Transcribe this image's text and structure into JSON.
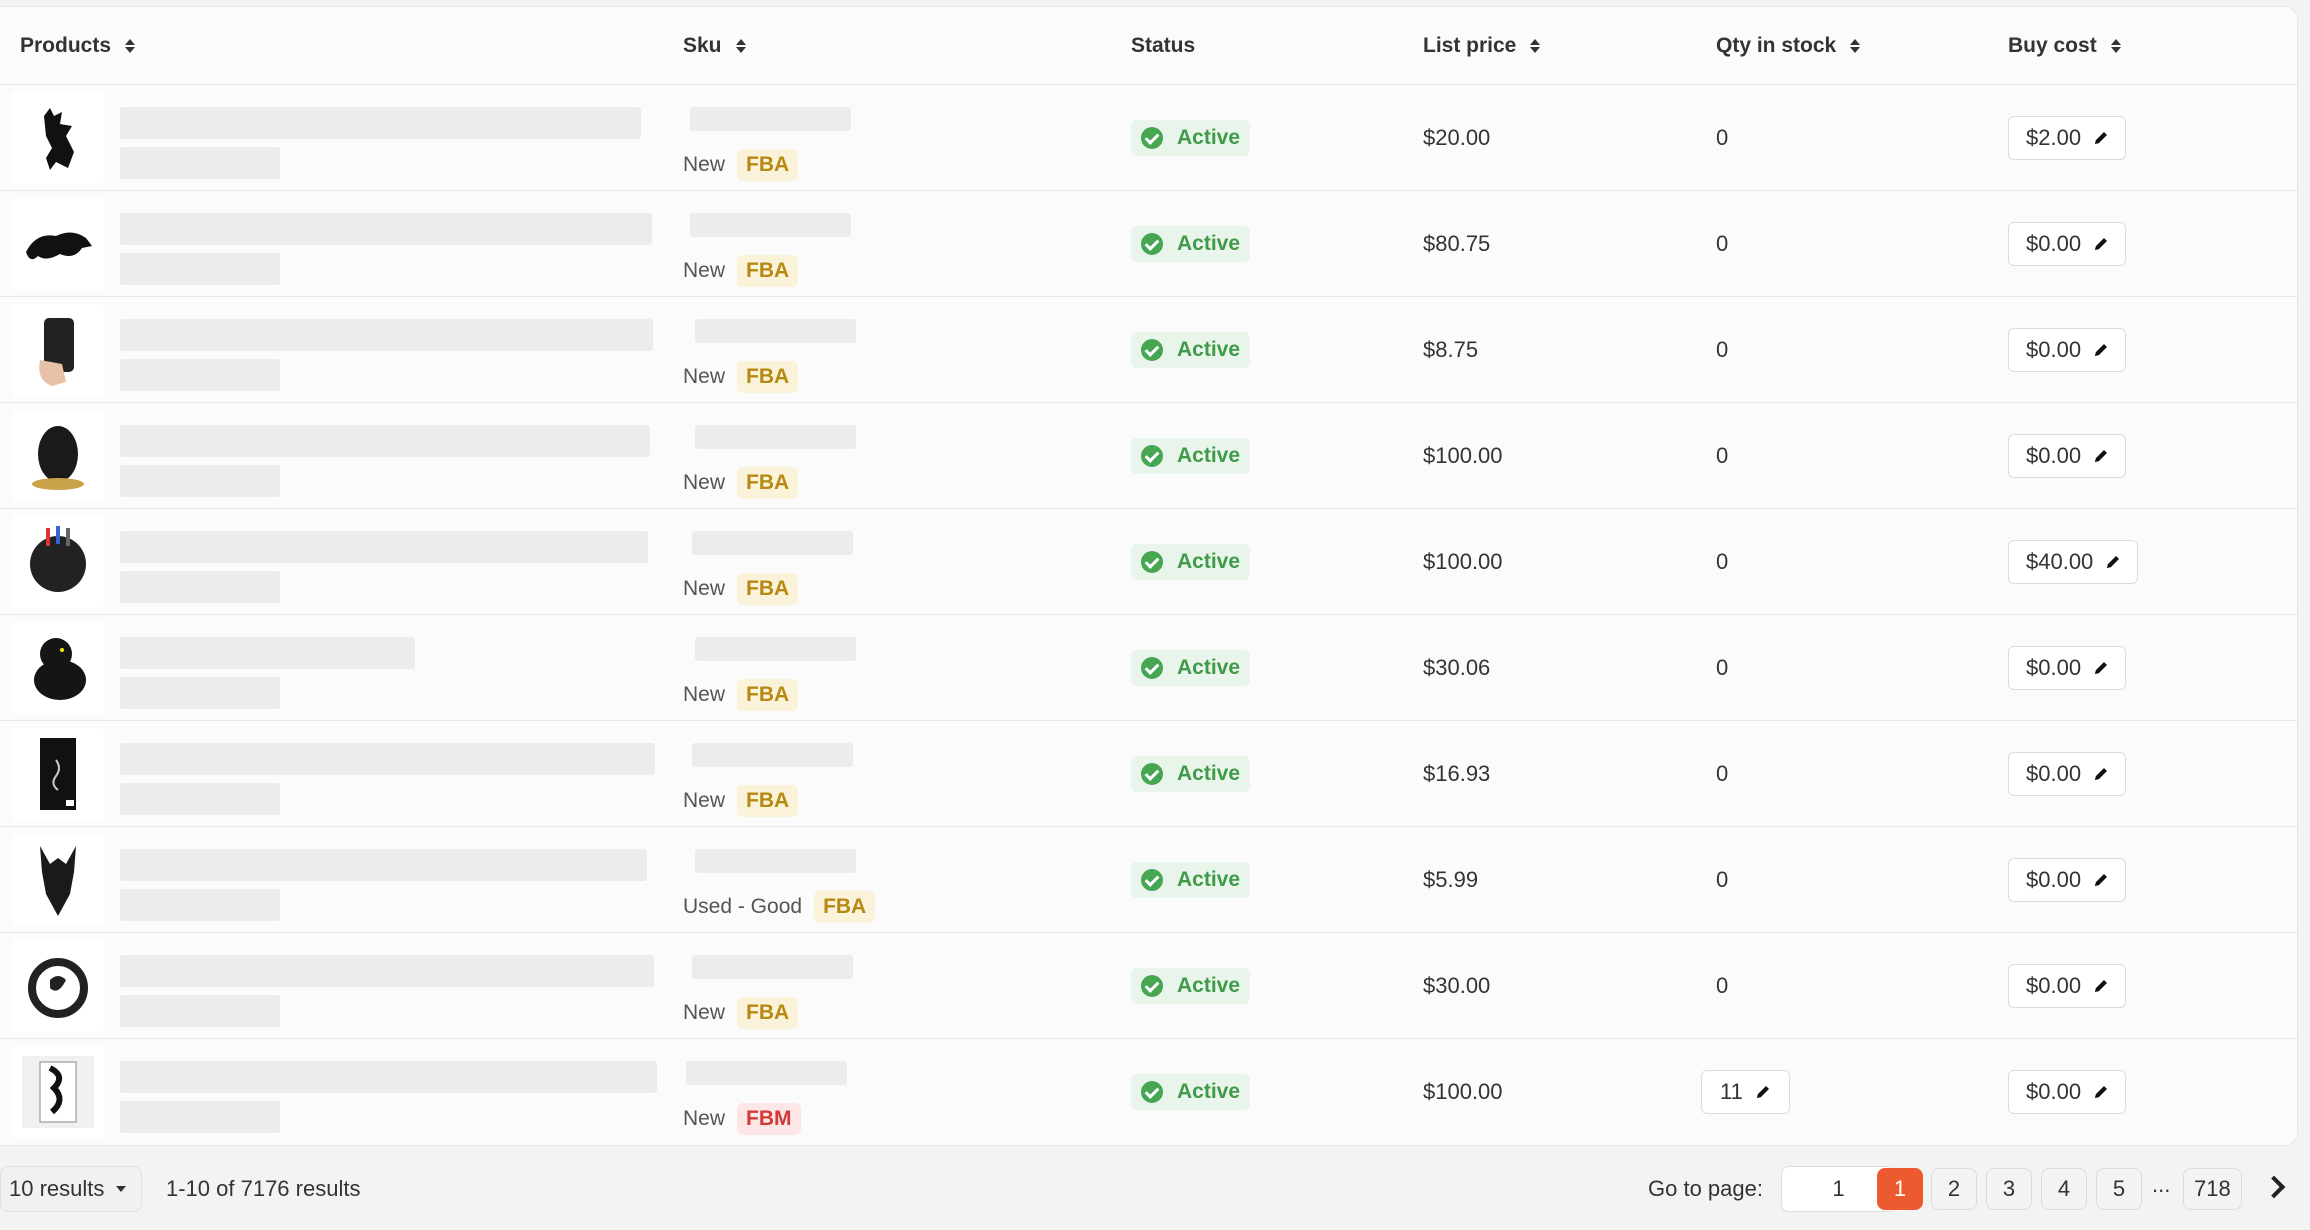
{
  "columns": {
    "products": "Products",
    "sku": "Sku",
    "status": "Status",
    "list_price": "List price",
    "qty": "Qty in stock",
    "buy_cost": "Buy cost"
  },
  "rows": [
    {
      "thumb_icon": "dragon-figure-icon",
      "condition": "New",
      "channel": "FBA",
      "status": "Active",
      "price": "$20.00",
      "qty": "0",
      "qty_editable": false,
      "cost": "$2.00"
    },
    {
      "thumb_icon": "dragon-toy-icon",
      "condition": "New",
      "channel": "FBA",
      "status": "Active",
      "price": "$80.75",
      "qty": "0",
      "qty_editable": false,
      "cost": "$0.00"
    },
    {
      "thumb_icon": "phone-case-icon",
      "condition": "New",
      "channel": "FBA",
      "status": "Active",
      "price": "$8.75",
      "qty": "0",
      "qty_editable": false,
      "cost": "$0.00"
    },
    {
      "thumb_icon": "dragon-egg-icon",
      "condition": "New",
      "channel": "FBA",
      "status": "Active",
      "price": "$100.00",
      "qty": "0",
      "qty_editable": false,
      "cost": "$0.00"
    },
    {
      "thumb_icon": "pen-holder-icon",
      "condition": "New",
      "channel": "FBA",
      "status": "Active",
      "price": "$100.00",
      "qty": "0",
      "qty_editable": false,
      "cost": "$40.00"
    },
    {
      "thumb_icon": "dragon-plush-icon",
      "condition": "New",
      "channel": "FBA",
      "status": "Active",
      "price": "$30.06",
      "qty": "0",
      "qty_editable": false,
      "cost": "$0.00"
    },
    {
      "thumb_icon": "book-icon",
      "condition": "New",
      "channel": "FBA",
      "status": "Active",
      "price": "$16.93",
      "qty": "0",
      "qty_editable": false,
      "cost": "$0.00"
    },
    {
      "thumb_icon": "dragon-head-icon",
      "condition": "Used - Good",
      "channel": "FBA",
      "status": "Active",
      "price": "$5.99",
      "qty": "0",
      "qty_editable": false,
      "cost": "$0.00"
    },
    {
      "thumb_icon": "dragon-ring-icon",
      "condition": "New",
      "channel": "FBA",
      "status": "Active",
      "price": "$30.00",
      "qty": "0",
      "qty_editable": false,
      "cost": "$0.00"
    },
    {
      "thumb_icon": "dragon-wall-art-icon",
      "condition": "New",
      "channel": "FBM",
      "status": "Active",
      "price": "$100.00",
      "qty": "11",
      "qty_editable": true,
      "cost": "$0.00"
    }
  ],
  "footer": {
    "per_page": "10 results",
    "range": "1-10 of 7176 results",
    "goto_label": "Go to page:",
    "goto_value": "1",
    "pages": [
      "1",
      "2",
      "3",
      "4",
      "5"
    ],
    "ellipsis": "...",
    "last_page": "718",
    "active_page": "1"
  },
  "colors": {
    "accent": "#ee5a2f",
    "active_status": "#46a652",
    "fba": "#b68a12",
    "fbm": "#d23a3a"
  }
}
